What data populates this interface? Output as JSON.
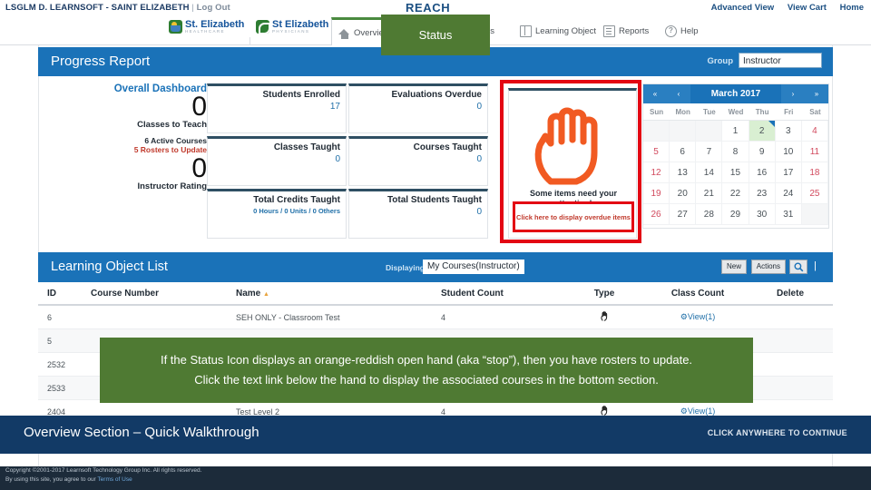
{
  "top": {
    "user_text": "LSGLM D. LEARNSOFT - SAINT ELIZABETH",
    "separator": "|",
    "logout": "Log Out",
    "brand": "REACH",
    "links": [
      "Advanced View",
      "View Cart",
      "Home"
    ]
  },
  "logos": [
    {
      "name": "St. Elizabeth",
      "tagline": "HEALTHCARE"
    },
    {
      "name": "St Elizabeth",
      "tagline": "PHYSICIANS"
    }
  ],
  "nav": [
    {
      "label": "Overview",
      "icon": "home-icon",
      "active": true
    },
    {
      "label": "Analytics",
      "icon": "chart-icon",
      "active": false
    },
    {
      "label": "Learning Object",
      "icon": "book-icon",
      "active": false
    },
    {
      "label": "Reports",
      "icon": "document-icon",
      "active": false
    },
    {
      "label": "Help",
      "icon": "help-icon",
      "active": false
    }
  ],
  "progress": {
    "title": "Progress Report",
    "group_label": "Group",
    "group_value": "Instructor"
  },
  "overall": {
    "title": "Overall Dashboard",
    "classes_to_teach_value": "0",
    "classes_to_teach_label": "Classes to Teach",
    "active_courses": "6 Active Courses",
    "rosters_to_update": "5 Rosters to Update",
    "instructor_rating_value": "0",
    "instructor_rating_label": "Instructor Rating"
  },
  "stats": [
    {
      "label": "Students Enrolled",
      "value": "17",
      "sub": ""
    },
    {
      "label": "Evaluations Overdue",
      "value": "0",
      "sub": ""
    },
    {
      "label": "Classes Taught",
      "value": "0",
      "sub": ""
    },
    {
      "label": "Courses Taught",
      "value": "0",
      "sub": ""
    },
    {
      "label": "Total Credits Taught",
      "value": "",
      "sub": "0 Hours / 0 Units / 0 Others"
    },
    {
      "label": "Total Students Taught",
      "value": "0",
      "sub": ""
    }
  ],
  "status_tile": {
    "icon": "open-hand-stop-icon",
    "icon_color": "#f15a22",
    "message": "Some items need your attention!",
    "link_text": "Click here to display overdue items",
    "highlight_color": "#e30613"
  },
  "calendar": {
    "prev_year": "«",
    "prev_month": "‹",
    "title": "March  2017",
    "next_month": "›",
    "next_year": "»",
    "dow": [
      "Sun",
      "Mon",
      "Tue",
      "Wed",
      "Thu",
      "Fri",
      "Sat"
    ],
    "weeks": [
      [
        "",
        "",
        "",
        "1",
        "2",
        "3",
        "4"
      ],
      [
        "5",
        "6",
        "7",
        "8",
        "9",
        "10",
        "11"
      ],
      [
        "12",
        "13",
        "14",
        "15",
        "16",
        "17",
        "18"
      ],
      [
        "19",
        "20",
        "21",
        "22",
        "23",
        "24",
        "25"
      ],
      [
        "26",
        "27",
        "28",
        "29",
        "30",
        "31",
        ""
      ]
    ],
    "today": "2"
  },
  "lol": {
    "title": "Learning Object List",
    "displaying_label": "Displaying",
    "filter_value": "My Courses(Instructor)",
    "new_label": "New",
    "actions_label": "Actions",
    "search_icon": "search-icon",
    "pipe": "|",
    "columns": [
      "ID",
      "Course Number",
      "Name",
      "Student Count",
      "Type",
      "Class Count",
      "Delete"
    ],
    "sort_column": "Name",
    "sort_caret": "▲",
    "rows": [
      {
        "id": "6",
        "course_number": "",
        "name": "SEH ONLY - Classroom Test",
        "student_count": "4",
        "type": "status-hand-icon",
        "class_count": "View(1)",
        "delete": ""
      },
      {
        "id": "5",
        "course_number": "",
        "name": "",
        "student_count": "",
        "type": "",
        "class_count": "",
        "delete": ""
      },
      {
        "id": "2532",
        "course_number": "",
        "name": "",
        "student_count": "",
        "type": "",
        "class_count": "",
        "delete": ""
      },
      {
        "id": "2533",
        "course_number": "",
        "name": "",
        "student_count": "",
        "type": "",
        "class_count": "",
        "delete": ""
      },
      {
        "id": "2404",
        "course_number": "",
        "name": "Test Level 2",
        "student_count": "4",
        "type": "status-hand-icon",
        "class_count": "View(1)",
        "delete": ""
      }
    ]
  },
  "callouts": {
    "status": "Status",
    "hand_line1": "If the Status Icon displays an orange-reddish open hand (aka “stop”), then you have rosters to update.",
    "hand_line2": "Click the text link below the hand to display the associated courses in the bottom section."
  },
  "bottom": {
    "title": "Overview Section – Quick Walkthrough",
    "hint": "CLICK ANYWHERE TO CONTINUE"
  },
  "footer": {
    "line1": "Copyright ©2001-2017 Learnsoft Technology Group Inc. All rights reserved.",
    "line2_pre": "By using this site, you agree to our ",
    "terms": "Terms of Use"
  }
}
